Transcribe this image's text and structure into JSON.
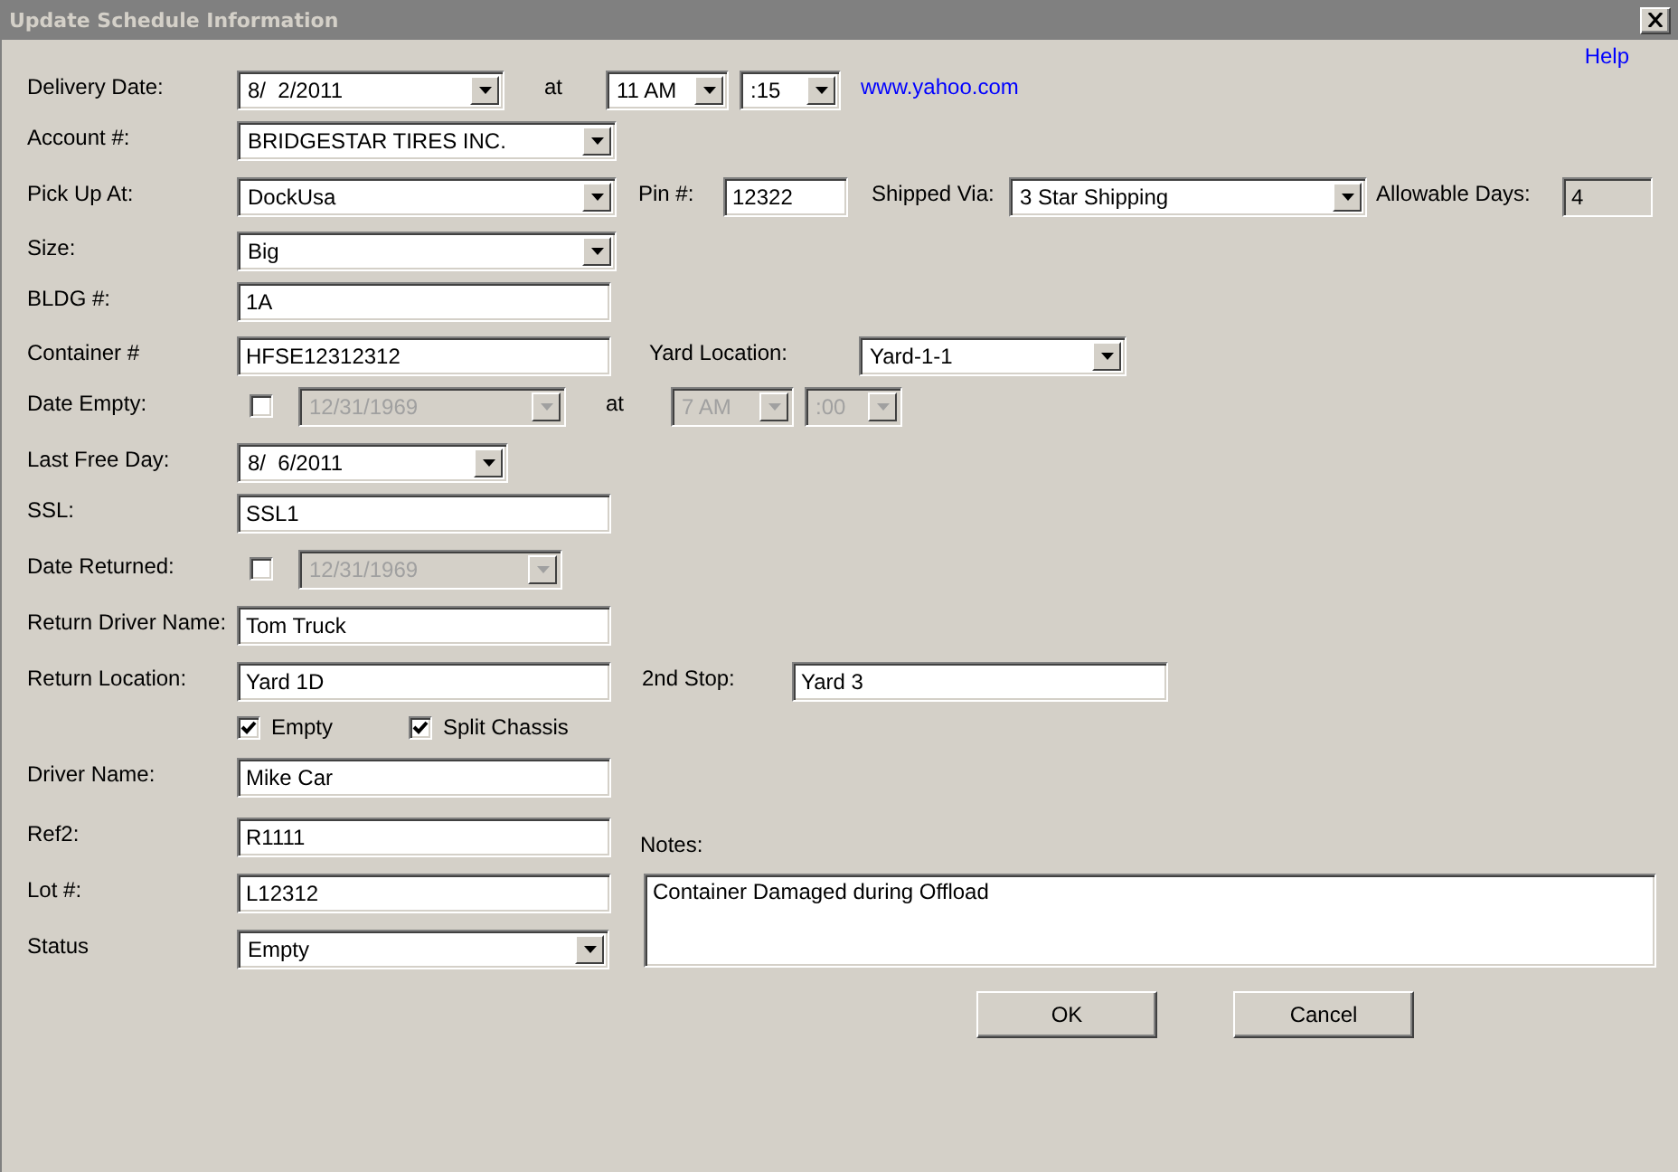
{
  "window": {
    "title": "Update Schedule Information"
  },
  "help_link": "Help",
  "rows": [
    {
      "label": "Delivery Date:",
      "items": [
        {
          "kind": "combo",
          "value": "8/  2/2011",
          "disabled": false
        },
        {
          "kind": "text",
          "text": "at"
        },
        {
          "kind": "combo",
          "value": "11 AM",
          "disabled": false
        },
        {
          "kind": "combo",
          "value": ":15",
          "disabled": false
        },
        {
          "kind": "link",
          "text": "www.yahoo.com"
        }
      ]
    },
    {
      "label": "Account #:",
      "items": [
        {
          "kind": "combo",
          "value": "BRIDGESTAR TIRES INC.",
          "disabled": false
        }
      ]
    },
    {
      "label": "Pick Up At:",
      "items": [
        {
          "kind": "combo",
          "value": "DockUsa",
          "disabled": false
        },
        {
          "kind": "text",
          "text": "Pin #:"
        },
        {
          "kind": "field",
          "value": "12322",
          "readonly": false
        },
        {
          "kind": "text",
          "text": "Shipped Via:"
        },
        {
          "kind": "combo",
          "value": "3 Star Shipping",
          "disabled": false
        },
        {
          "kind": "text",
          "text": "Allowable Days:"
        },
        {
          "kind": "field",
          "value": "4",
          "readonly": true
        }
      ]
    },
    {
      "label": "Size:",
      "items": [
        {
          "kind": "combo",
          "value": "Big",
          "disabled": false
        }
      ]
    },
    {
      "label": "BLDG #:",
      "items": [
        {
          "kind": "field",
          "value": "1A",
          "readonly": false
        }
      ]
    },
    {
      "label": "Container #",
      "items": [
        {
          "kind": "field",
          "value": "HFSE12312312",
          "readonly": false
        },
        {
          "kind": "text",
          "text": "Yard Location:"
        },
        {
          "kind": "combo",
          "value": "Yard-1-1",
          "disabled": false
        }
      ]
    },
    {
      "label": "Date Empty:",
      "items": [
        {
          "kind": "check",
          "checked": false
        },
        {
          "kind": "combo",
          "value": "12/31/1969",
          "disabled": true
        },
        {
          "kind": "text",
          "text": "at"
        },
        {
          "kind": "combo",
          "value": "7 AM",
          "disabled": true
        },
        {
          "kind": "combo",
          "value": ":00",
          "disabled": true
        }
      ]
    },
    {
      "label": "Last Free Day:",
      "items": [
        {
          "kind": "combo",
          "value": "8/  6/2011",
          "disabled": false
        }
      ]
    },
    {
      "label": "SSL:",
      "items": [
        {
          "kind": "field",
          "value": "SSL1",
          "readonly": false
        }
      ]
    },
    {
      "label": "Date Returned:",
      "items": [
        {
          "kind": "check",
          "checked": false
        },
        {
          "kind": "combo",
          "value": "12/31/1969",
          "disabled": true
        }
      ]
    },
    {
      "label": "Return Driver Name:",
      "items": [
        {
          "kind": "field",
          "value": "Tom Truck",
          "readonly": false
        }
      ]
    },
    {
      "label": "Return Location:",
      "items": [
        {
          "kind": "field",
          "value": "Yard 1D",
          "readonly": false
        },
        {
          "kind": "text",
          "text": "2nd Stop:"
        },
        {
          "kind": "field",
          "value": "Yard 3",
          "readonly": false
        }
      ]
    },
    {
      "items": [
        {
          "kind": "check",
          "checked": true,
          "label": "Empty"
        },
        {
          "kind": "check",
          "checked": true,
          "label": "Split Chassis"
        }
      ]
    },
    {
      "label": "Driver Name:",
      "items": [
        {
          "kind": "field",
          "value": "Mike Car",
          "readonly": false
        }
      ]
    },
    {
      "label": "Ref2:",
      "items": [
        {
          "kind": "field",
          "value": "R1111",
          "readonly": false
        }
      ]
    },
    {
      "label": "Lot #:",
      "items": [
        {
          "kind": "field",
          "value": "L12312",
          "readonly": false
        }
      ]
    },
    {
      "label": "Status",
      "items": [
        {
          "kind": "combo",
          "value": "Empty",
          "disabled": false
        }
      ]
    }
  ],
  "notes": {
    "label": "Notes:",
    "value": "Container Damaged during Offload"
  },
  "buttons": [
    "OK",
    "Cancel"
  ]
}
